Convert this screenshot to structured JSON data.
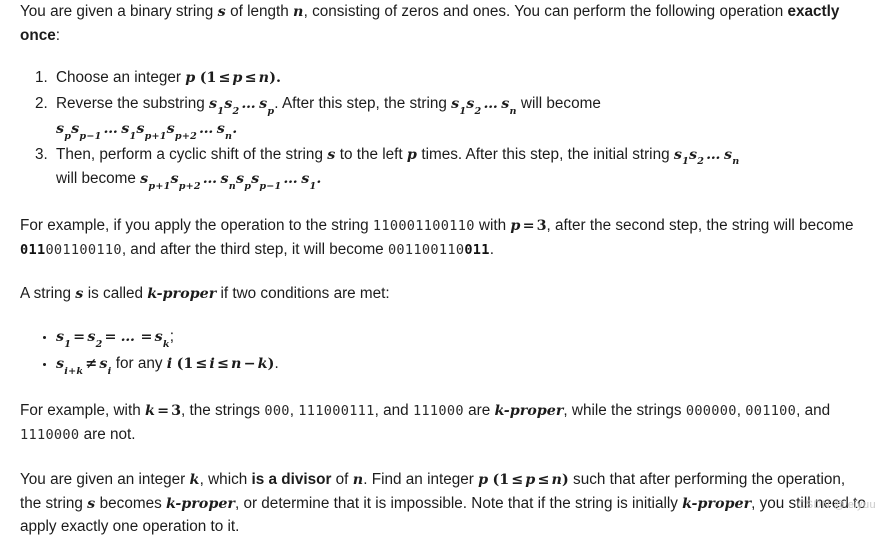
{
  "document": {
    "type": "problem-statement",
    "background_color": "#ffffff",
    "text_color": "#1c1c1c",
    "watermark": "CSDN @'eiyuu",
    "intro": {
      "text_1": "You are given a binary string ",
      "var_s": "s",
      "text_2": " of length ",
      "var_n": "n",
      "text_3": ", consisting of zeros and ones. You can perform the following operation ",
      "bold_exactly_once": "exactly once",
      "text_4": ":"
    },
    "steps": [
      {
        "text_1": "Choose an integer ",
        "var_p": "p",
        "paren_open": "(1",
        "le_1": "≤",
        "var_p2": "p",
        "le_2": "≤",
        "var_n": "n",
        "paren_close": ")."
      },
      {
        "text_1": "Reverse the substring ",
        "sub_expr_1": "s1s2 ... sp",
        "text_2": ". After this step, the string ",
        "sub_expr_2": "s1s2 ... sn",
        "text_3": " will become",
        "result_line": "spsp-1 ... s1sp+1sp+2 ... sn."
      },
      {
        "text_1": "Then, perform a cyclic shift of the string ",
        "var_s": "s",
        "text_2": " to the left ",
        "var_p": "p",
        "text_3": " times. After this step, the initial string ",
        "sub_expr_1": "s1s2 ... sn",
        "text_4": "will become ",
        "result_expr": "sp+1sp+2 ... snspsp-1 ... s1",
        "text_5": "."
      }
    ],
    "example_1": {
      "text_1": "For example, if you apply the operation to the string ",
      "string_input": "110001100110",
      "text_2": " with ",
      "var_p": "p",
      "eq": "=",
      "val_p": "3",
      "text_3": ", after the second step, the string will become ",
      "string_after_2_bold": "011",
      "string_after_2_rest": "001100110",
      "text_4": ", and after the third step, it will become ",
      "string_after_3_rest": "001100110",
      "string_after_3_bold": "011",
      "text_5": "."
    },
    "definition": {
      "text_1": "A string ",
      "var_s": "s",
      "text_2": " is called ",
      "term": "k-proper",
      "text_3": " if two conditions are met:"
    },
    "conditions": [
      {
        "expr": "s1 = s2 = ... = sk",
        "suffix": ";"
      },
      {
        "expr": "si+k ≠ si",
        "text": " for any ",
        "var_i": "i",
        "range": "(1 ≤ i ≤ n − k)",
        "suffix": "."
      }
    ],
    "example_2": {
      "text_1": "For example, with ",
      "var_k": "k",
      "eq": "=",
      "val_k": "3",
      "text_2": ", the strings ",
      "str_a": "000",
      "sep_1": ", ",
      "str_b": "111000111",
      "text_3": ", and ",
      "str_c": "111000",
      "text_4": " are ",
      "term": "k-proper",
      "text_5": ", while the strings ",
      "str_d": "000000",
      "sep_2": ", ",
      "str_e": "001100",
      "text_6": ", and ",
      "str_f": "1110000",
      "text_7": " are not."
    },
    "task": {
      "text_1": "You are given an integer ",
      "var_k": "k",
      "text_2": ", which ",
      "bold_divisor": "is a divisor",
      "text_3": " of ",
      "var_n": "n",
      "text_4": ". Find an integer ",
      "var_p": "p",
      "range": "(1 ≤ p ≤ n)",
      "text_5": " such that after performing the operation, the string ",
      "var_s": "s",
      "text_6": " becomes ",
      "term_1": "k-proper",
      "text_7": ", or determine that it is impossible. Note that if the string is initially ",
      "term_2": "k-proper",
      "text_8": ", you still need to apply exactly one operation to it."
    }
  }
}
